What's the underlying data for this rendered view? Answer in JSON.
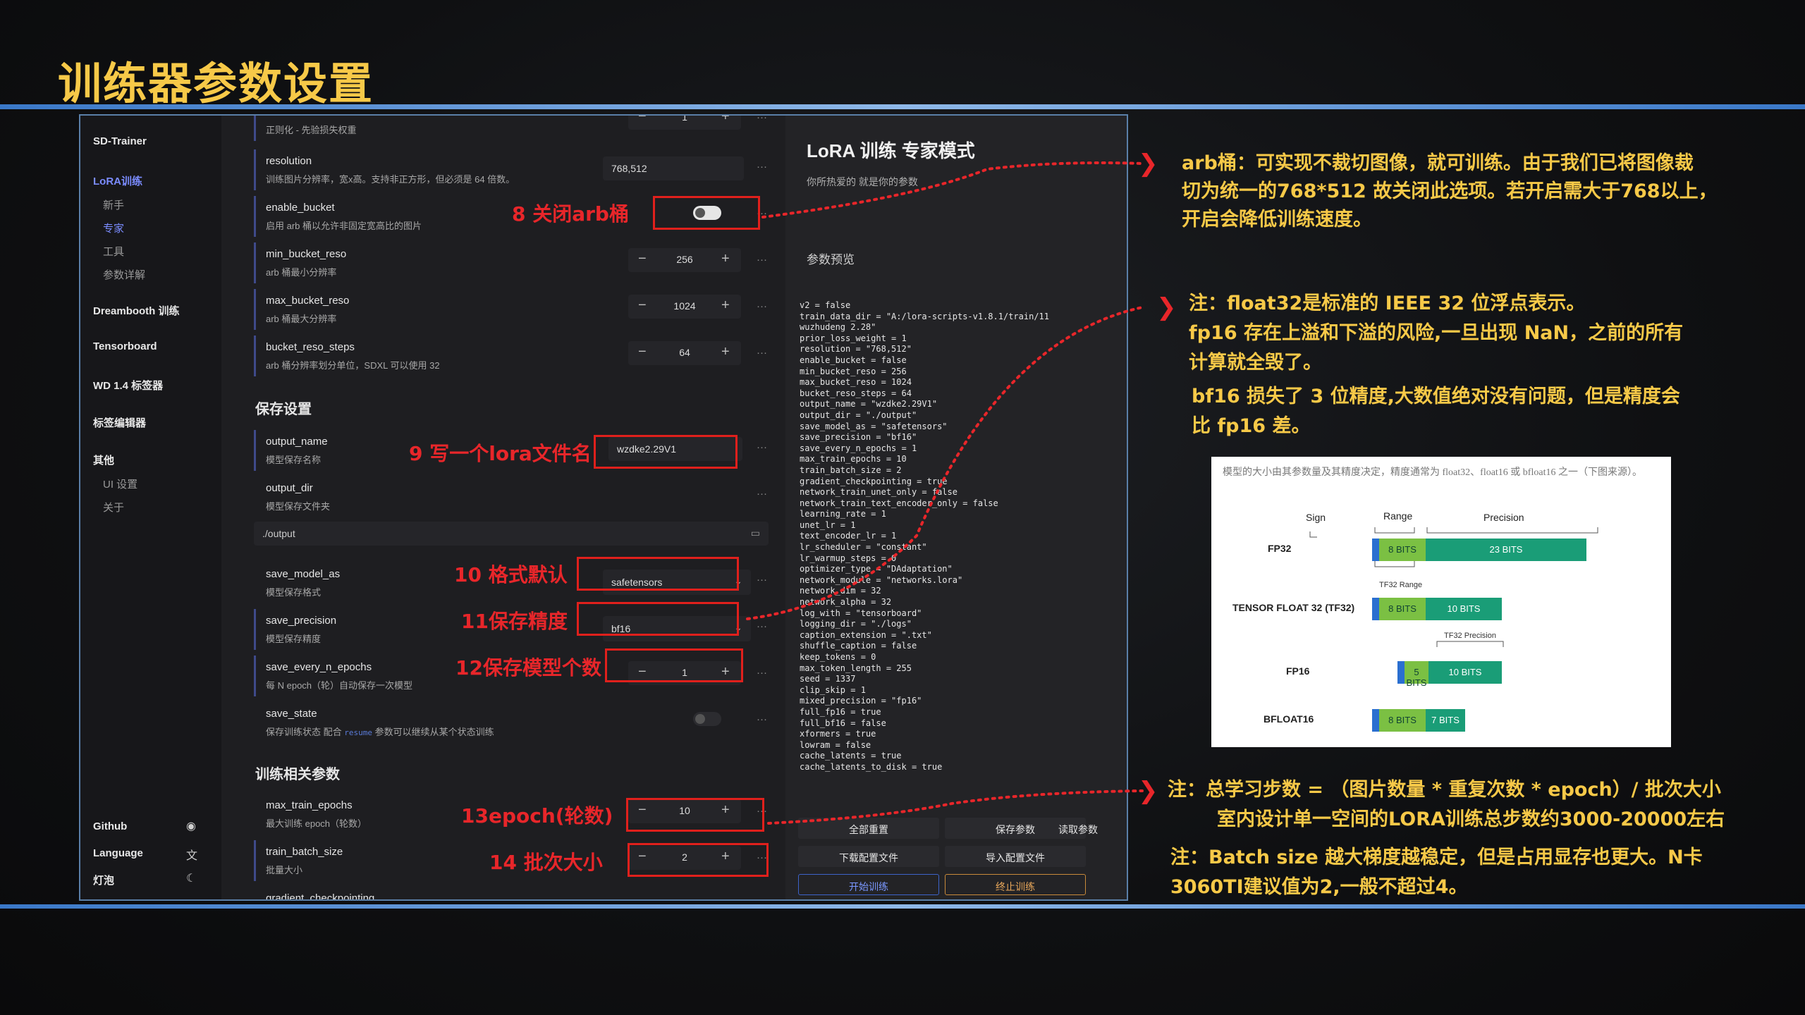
{
  "slide": {
    "title": "训练器参数设置"
  },
  "sidebar": {
    "app_name": "SD-Trainer",
    "lora": "LoRA训练",
    "lora_sub": [
      "新手",
      "专家",
      "工具",
      "参数详解"
    ],
    "dreambooth": "Dreambooth 训练",
    "tensorboard": "Tensorboard",
    "wd_tagger": "WD 1.4 标签器",
    "tag_editor": "标签编辑器",
    "others": "其他",
    "others_sub": [
      "UI 设置",
      "关于"
    ],
    "github": "Github",
    "language": "Language",
    "light": "灯泡"
  },
  "form": {
    "top_desc": "正则化 - 先验损失权重",
    "top_value": "1",
    "resolution": {
      "name": "resolution",
      "desc": "训练图片分辨率，宽x高。支持非正方形，但必须是 64 倍数。",
      "value": "768,512"
    },
    "enable_bucket": {
      "name": "enable_bucket",
      "desc": "启用 arb 桶以允许非固定宽高比的图片"
    },
    "min_bucket_reso": {
      "name": "min_bucket_reso",
      "desc": "arb 桶最小分辨率",
      "value": "256"
    },
    "max_bucket_reso": {
      "name": "max_bucket_reso",
      "desc": "arb 桶最大分辨率",
      "value": "1024"
    },
    "bucket_reso_steps": {
      "name": "bucket_reso_steps",
      "desc": "arb 桶分辨率划分单位，SDXL 可以使用 32",
      "value": "64"
    },
    "save_section": "保存设置",
    "output_name": {
      "name": "output_name",
      "desc": "模型保存名称",
      "value": "wzdke2.29V1"
    },
    "output_dir": {
      "name": "output_dir",
      "desc": "模型保存文件夹",
      "value": "./output"
    },
    "save_model_as": {
      "name": "save_model_as",
      "desc": "模型保存格式",
      "value": "safetensors"
    },
    "save_precision": {
      "name": "save_precision",
      "desc": "模型保存精度",
      "value": "bf16"
    },
    "save_every_n_epochs": {
      "name": "save_every_n_epochs",
      "desc": "每 N epoch（轮）自动保存一次模型",
      "value": "1"
    },
    "save_state": {
      "name": "save_state",
      "desc_pre": "保存训练状态 配合",
      "desc_code": "resume",
      "desc_post": "参数可以继续从某个状态训练"
    },
    "train_section": "训练相关参数",
    "max_train_epochs": {
      "name": "max_train_epochs",
      "desc": "最大训练 epoch（轮数）",
      "value": "10"
    },
    "train_batch_size": {
      "name": "train_batch_size",
      "desc": "批量大小",
      "value": "2"
    },
    "next_name": "gradient_checkpointing"
  },
  "panel": {
    "title": "LoRA 训练 专家模式",
    "subtitle": "你所热爱的 就是你的参数",
    "preview": "参数预览",
    "code": "v2 = false\ntrain_data_dir = \"A:/lora-scripts-v1.8.1/train/11\nwuzhudeng 2.28\"\nprior_loss_weight = 1\nresolution = \"768,512\"\nenable_bucket = false\nmin_bucket_reso = 256\nmax_bucket_reso = 1024\nbucket_reso_steps = 64\noutput_name = \"wzdke2.29V1\"\noutput_dir = \"./output\"\nsave_model_as = \"safetensors\"\nsave_precision = \"bf16\"\nsave_every_n_epochs = 1\nmax_train_epochs = 10\ntrain_batch_size = 2\ngradient_checkpointing = true\nnetwork_train_unet_only = false\nnetwork_train_text_encoder_only = false\nlearning_rate = 1\nunet_lr = 1\ntext_encoder_lr = 1\nlr_scheduler = \"constant\"\nlr_warmup_steps = 0\noptimizer_type = \"DAdaptation\"\nnetwork_module = \"networks.lora\"\nnetwork_dim = 32\nnetwork_alpha = 32\nlog_with = \"tensorboard\"\nlogging_dir = \"./logs\"\ncaption_extension = \".txt\"\nshuffle_caption = false\nkeep_tokens = 0\nmax_token_length = 255\nseed = 1337\nclip_skip = 1\nmixed_precision = \"fp16\"\nfull_fp16 = true\nfull_bf16 = false\nxformers = true\nlowram = false\ncache_latents = true\ncache_latents_to_disk = true",
    "btn_reset": "全部重置",
    "btn_save": "保存参数",
    "btn_load": "读取参数",
    "btn_download": "下载配置文件",
    "btn_import": "导入配置文件",
    "btn_start": "开始训练",
    "btn_stop": "终止训练"
  },
  "annotations": {
    "a8": "8 关闭arb桶",
    "a9": "9 写一个lora文件名",
    "a10": "10 格式默认",
    "a11": "11保存精度",
    "a12": "12保存模型个数",
    "a13": "13epoch(轮数)",
    "a14": "14 批次大小"
  },
  "notes": {
    "arb": [
      "arb桶：可实现不裁切图像，就可训练。由于我们已将图像裁",
      "切为统一的768*512 故关闭此选项。若开启需大于768以上，",
      "开启会降低训练速度。"
    ],
    "fp": [
      "注：float32是标准的 IEEE 32 位浮点表示。",
      "fp16  存在上溢和下溢的风险,一旦出现 NaN，之前的所有",
      "计算就全毁了。"
    ],
    "bf": [
      "bf16  损失了 3 位精度,大数值绝对没有问题，但是精度会",
      "比 fp16 差。"
    ],
    "steps": [
      "注：总学习步数 = （图片数量 * 重复次数 * epoch）/ 批次大小",
      "室内设计单一空间的LORA训练总步数约3000-20000左右"
    ],
    "batch": [
      "注：Batch size 越大梯度越稳定，但是占用显存也更大。N卡",
      "3060TI建议值为2,一般不超过4。"
    ]
  },
  "figure": {
    "caption": "模型的大小由其参数量及其精度决定，精度通常为 float32、float16 或 bfloat16 之一（下图来源）。",
    "sign": "Sign",
    "range": "Range",
    "precision": "Precision",
    "fp32": "FP32",
    "tf32": "TENSOR FLOAT 32 (TF32)",
    "fp16": "FP16",
    "bf16": "BFLOAT16",
    "tf32_range": "TF32 Range",
    "tf32_precision": "TF32 Precision",
    "b8": "8 BITS",
    "b23": "23 BITS",
    "b10": "10 BITS",
    "b5": "5 BITS",
    "b7": "7 BITS"
  }
}
